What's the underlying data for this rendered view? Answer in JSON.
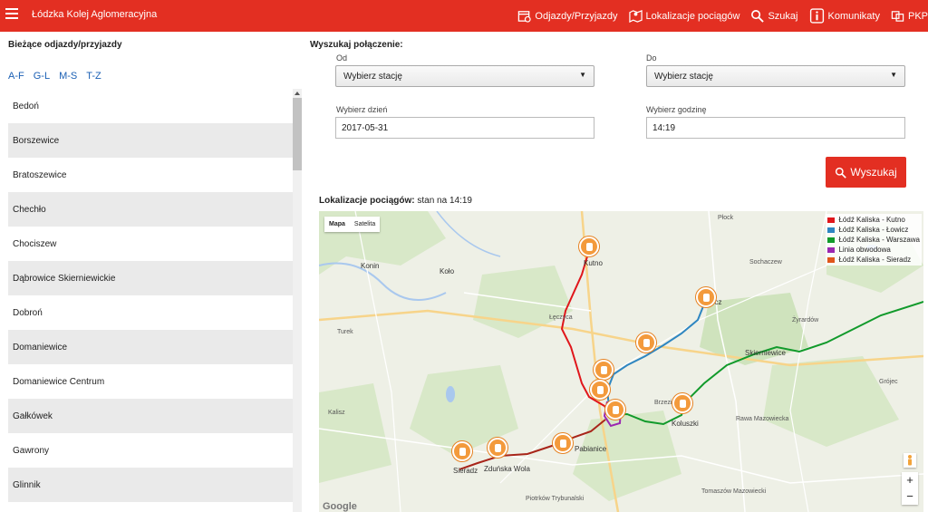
{
  "header": {
    "brand": "Łódzka Kolej Aglomeracyjna",
    "nav": [
      {
        "label": "Odjazdy/Przyjazdy",
        "icon": "calendar-icon"
      },
      {
        "label": "Lokalizacje pociągów",
        "icon": "map-icon"
      },
      {
        "label": "Szukaj",
        "icon": "search-icon"
      },
      {
        "label": "Komunikaty",
        "icon": "info-icon"
      },
      {
        "label": "PKP",
        "icon": "pkp-icon"
      }
    ]
  },
  "left": {
    "title": "Bieżące odjazdy/przyjazdy",
    "filters": [
      "A-F",
      "G-L",
      "M-S",
      "T-Z"
    ],
    "stations": [
      "Bedoń",
      "Borszewice",
      "Bratoszewice",
      "Chechło",
      "Chociszew",
      "Dąbrowice Skierniewickie",
      "Dobroń",
      "Domaniewice",
      "Domaniewice Centrum",
      "Gałkówek",
      "Gawrony",
      "Glinnik"
    ]
  },
  "search": {
    "title": "Wyszukaj połączenie:",
    "from_label": "Od",
    "from_value": "Wybierz stację",
    "to_label": "Do",
    "to_value": "Wybierz stację",
    "day_label": "Wybierz dzień",
    "day_value": "2017-05-31",
    "time_label": "Wybierz godzinę",
    "time_value": "14:19",
    "button": "Wyszukaj"
  },
  "locations": {
    "title": "Lokalizacje pociągów:",
    "status": "stan na 14:19"
  },
  "map": {
    "types": [
      "Mapa",
      "Satelita"
    ],
    "legend": [
      {
        "label": "Łódź Kaliska - Kutno",
        "color": "#e0161b"
      },
      {
        "label": "Łódź Kaliska - Łowicz",
        "color": "#2e86c1"
      },
      {
        "label": "Łódź Kaliska - Warszawa",
        "color": "#119a2b"
      },
      {
        "label": "Linia obwodowa",
        "color": "#9b27b0"
      },
      {
        "label": "Łódź Kaliska - Sieradz",
        "color": "#e0561b"
      }
    ],
    "places": [
      {
        "name": "Kutno",
        "big": true
      },
      {
        "name": "Łowicz",
        "big": true
      },
      {
        "name": "Skierniewice",
        "big": true
      },
      {
        "name": "Koluszki",
        "big": true
      },
      {
        "name": "Sieradz",
        "big": true
      },
      {
        "name": "Zduńska Wola",
        "big": true
      },
      {
        "name": "Pabianice",
        "big": true
      },
      {
        "name": "Konin",
        "big": true
      },
      {
        "name": "Koło",
        "big": true
      },
      {
        "name": "Łęczyca",
        "big": false
      },
      {
        "name": "Sochaczew",
        "big": false
      },
      {
        "name": "Żyrardów",
        "big": false
      },
      {
        "name": "Brzeziny",
        "big": false
      },
      {
        "name": "Tomaszów Mazowiecki",
        "big": false
      },
      {
        "name": "Kalisz",
        "big": false
      },
      {
        "name": "Turek",
        "big": false
      },
      {
        "name": "Płock",
        "big": false
      },
      {
        "name": "Grójec",
        "big": false
      },
      {
        "name": "Rawa Mazowiecka",
        "big": false
      },
      {
        "name": "Piotrków Trybunalski",
        "big": false
      }
    ],
    "zoom_in": "+",
    "zoom_out": "−",
    "attribution": "Google"
  }
}
